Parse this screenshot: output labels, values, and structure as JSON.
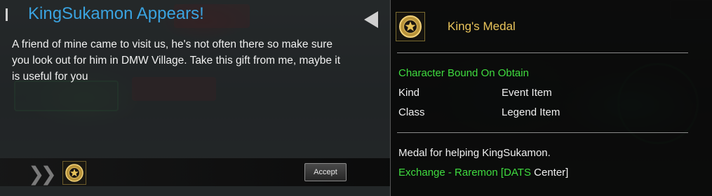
{
  "quest": {
    "title": "KingSukamon Appears!",
    "body": "A friend of mine came to visit us, he's not often there so make sure you look out for him in DMW Village. Take this gift from me, maybe it is useful for you",
    "accept_label": "Accept"
  },
  "item": {
    "name": "King's Medal",
    "bound": "Character Bound On Obtain",
    "kind_label": "Kind",
    "kind_value": "Event Item",
    "class_label": "Class",
    "class_value": "Legend Item",
    "description": "Medal for helping KingSukamon.",
    "exchange_prefix": "Exchange - Raremon [DATS",
    "exchange_suffix": "Center]"
  },
  "colors": {
    "quest_title": "#3aa3e0",
    "item_name": "#e8c35a",
    "green_text": "#3fdc3f"
  }
}
